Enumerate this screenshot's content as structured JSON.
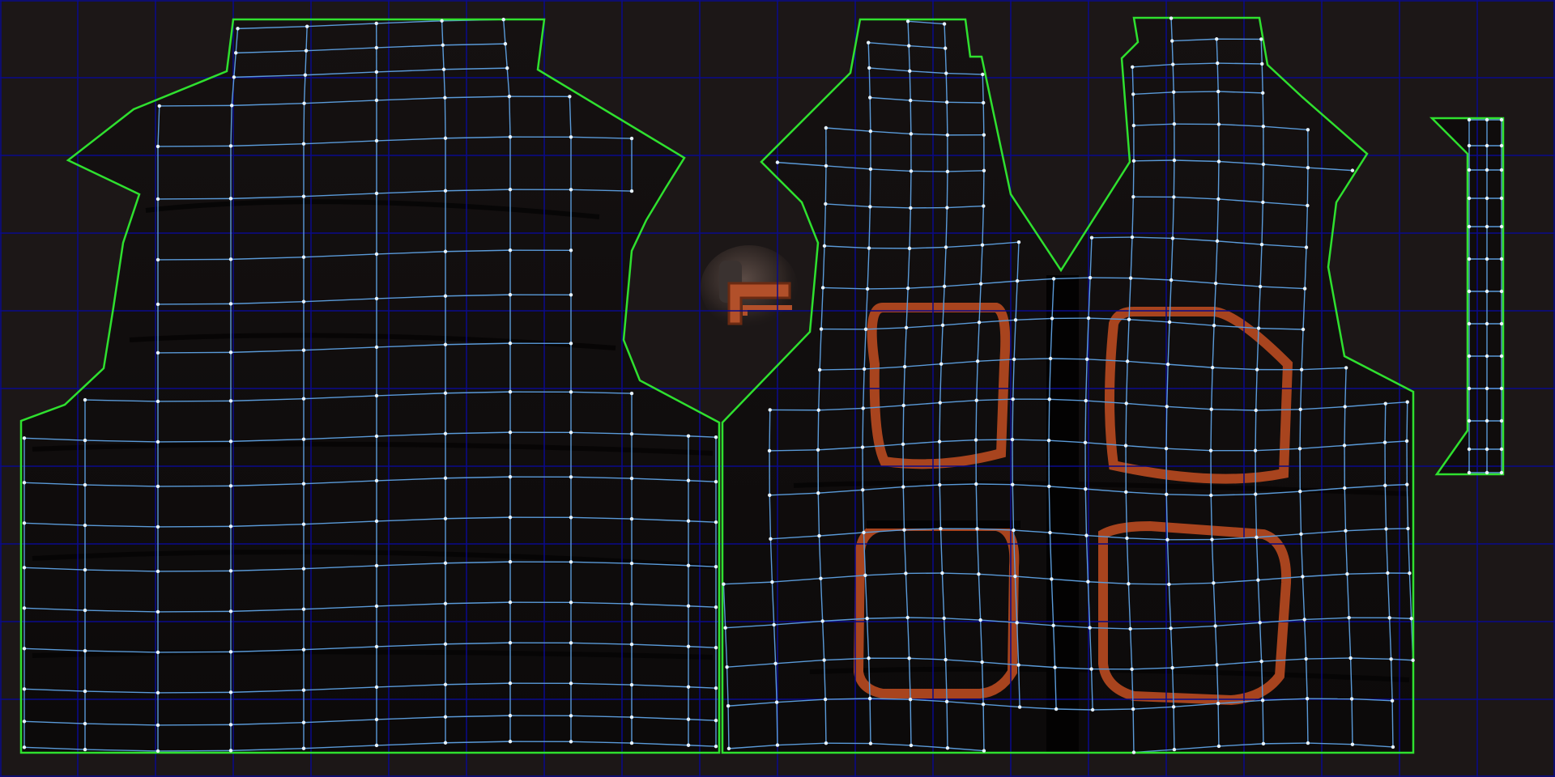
{
  "editor": {
    "view": "uv-layout",
    "grid": {
      "columns": 10,
      "rows": 5,
      "visible": true,
      "color": "#0a0a8c"
    },
    "background_color": "#1c1717",
    "texture": {
      "subject": "vest",
      "base_color": "#0d0b0b",
      "accent_color": "#a8441e"
    },
    "shell_border_color": "#2fe02f",
    "mesh_edge_color": "#5a9ad8",
    "vertex_color": "#e8f4ff"
  },
  "uv_shells": [
    {
      "id": "vest-back-panel",
      "label": ""
    },
    {
      "id": "vest-front-panel",
      "label": ""
    },
    {
      "id": "collar-strip",
      "label": ""
    },
    {
      "id": "button-island",
      "label": ""
    }
  ],
  "pockets": [
    {
      "id": "pocket-upper-left"
    },
    {
      "id": "pocket-upper-right"
    },
    {
      "id": "pocket-lower-left"
    },
    {
      "id": "pocket-lower-right"
    }
  ]
}
